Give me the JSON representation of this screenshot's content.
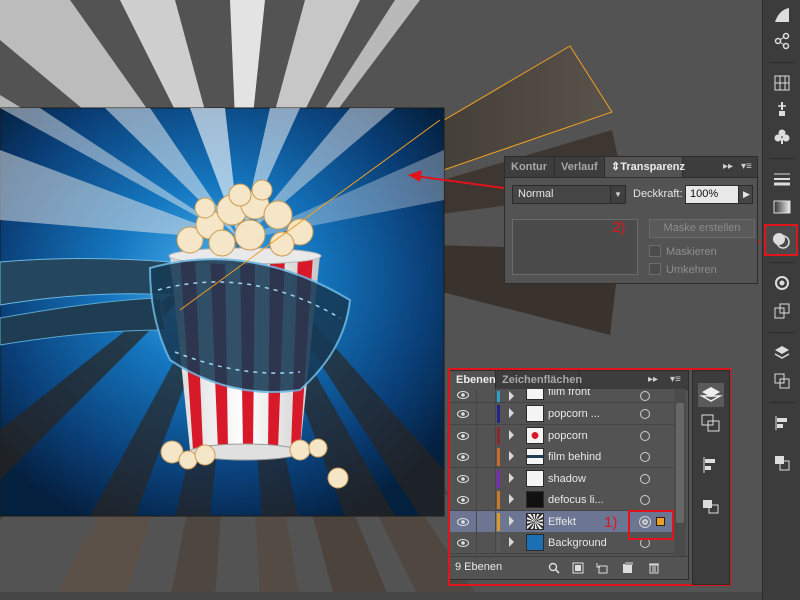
{
  "transparency_panel": {
    "tabs": [
      {
        "label": "Kontur"
      },
      {
        "label": "Verlauf"
      },
      {
        "label": "Transparenz"
      }
    ],
    "blend_mode": "Normal",
    "opacity_label": "Deckkraft:",
    "opacity_value": "100%",
    "make_mask_button": "Maske erstellen",
    "clip_label": "Maskieren",
    "invert_label": "Umkehren",
    "annotation_number": "2)"
  },
  "layers_panel": {
    "tabs": [
      {
        "label": "Ebenen"
      },
      {
        "label": "Zeichenflächen"
      }
    ],
    "layers": [
      {
        "name": "film front",
        "color": "#2fa0c8"
      },
      {
        "name": "popcorn ...",
        "color": "#24248c"
      },
      {
        "name": "popcorn",
        "color": "#8c2a2a"
      },
      {
        "name": "film behind",
        "color": "#c86a2a"
      },
      {
        "name": "shadow",
        "color": "#7a2ab8"
      },
      {
        "name": "defocus li...",
        "color": "#c87a2a"
      },
      {
        "name": "Effekt",
        "color": "#e09a20",
        "selected": true
      },
      {
        "name": "Background",
        "color": "#585858"
      }
    ],
    "count_label": "9 Ebenen",
    "annotation_number": "1)"
  },
  "colors": {
    "accent_red": "#e0141b",
    "selection_orange": "#f0a020",
    "canvas_blue": "#0d4f8c"
  },
  "tool_strip_icons": [
    "gradient-swatch-icon",
    "links-icon",
    "grid-icon",
    "brush-tip-icon",
    "club-symbol-icon",
    "stroke-lines-icon",
    "gradient-box-icon",
    "transparency-icon",
    "appearance-icon",
    "export-icon",
    "layers-icon",
    "artboards-icon",
    "align-icon",
    "pathfinder-icon"
  ]
}
